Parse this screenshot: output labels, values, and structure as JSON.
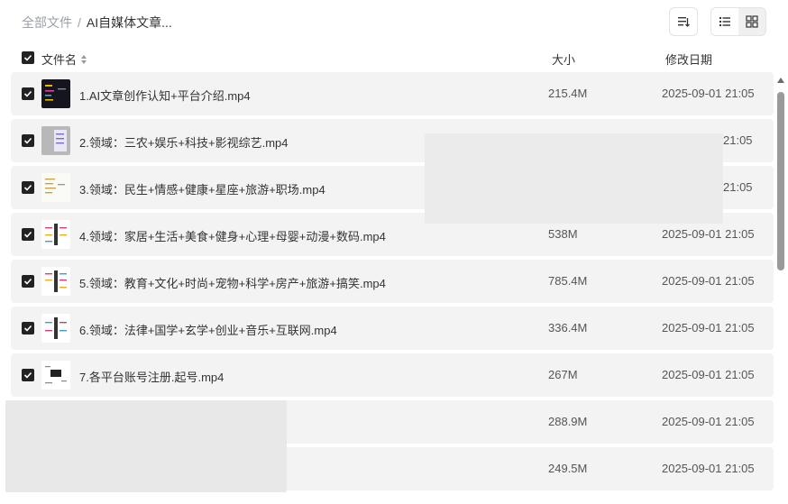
{
  "breadcrumb": {
    "root": "全部文件",
    "separator": "/",
    "current": "AI自媒体文章..."
  },
  "toolbar": {
    "sort_icon": "sort-icon",
    "list_view_icon": "list-view-icon",
    "grid_view_icon": "grid-view-icon"
  },
  "table": {
    "header": {
      "name": "文件名",
      "size": "大小",
      "date": "修改日期"
    },
    "rows": [
      {
        "name": "1.AI文章创作认知+平台介绍.mp4",
        "size": "215.4M",
        "date": "2025-09-01 21:05"
      },
      {
        "name": "2.领域：三农+娱乐+科技+影视综艺.mp4",
        "size": "",
        "date": "21:05"
      },
      {
        "name": "3.领域：民生+情感+健康+星座+旅游+职场.mp4",
        "size": "",
        "date": "21:05"
      },
      {
        "name": "4.领域：家居+生活+美食+健身+心理+母婴+动漫+数码.mp4",
        "size": "538M",
        "date": "2025-09-01 21:05"
      },
      {
        "name": "5.领域：教育+文化+时尚+宠物+科学+房产+旅游+搞笑.mp4",
        "size": "785.4M",
        "date": "2025-09-01 21:05"
      },
      {
        "name": "6.领域：法律+国学+玄学+创业+音乐+互联网.mp4",
        "size": "336.4M",
        "date": "2025-09-01 21:05"
      },
      {
        "name": "7.各平台账号注册.起号.mp4",
        "size": "267M",
        "date": "2025-09-01 21:05"
      },
      {
        "name": "",
        "size": "288.9M",
        "date": "2025-09-01 21:05"
      },
      {
        "name": "",
        "size": "249.5M",
        "date": "2025-09-01 21:05"
      }
    ]
  }
}
